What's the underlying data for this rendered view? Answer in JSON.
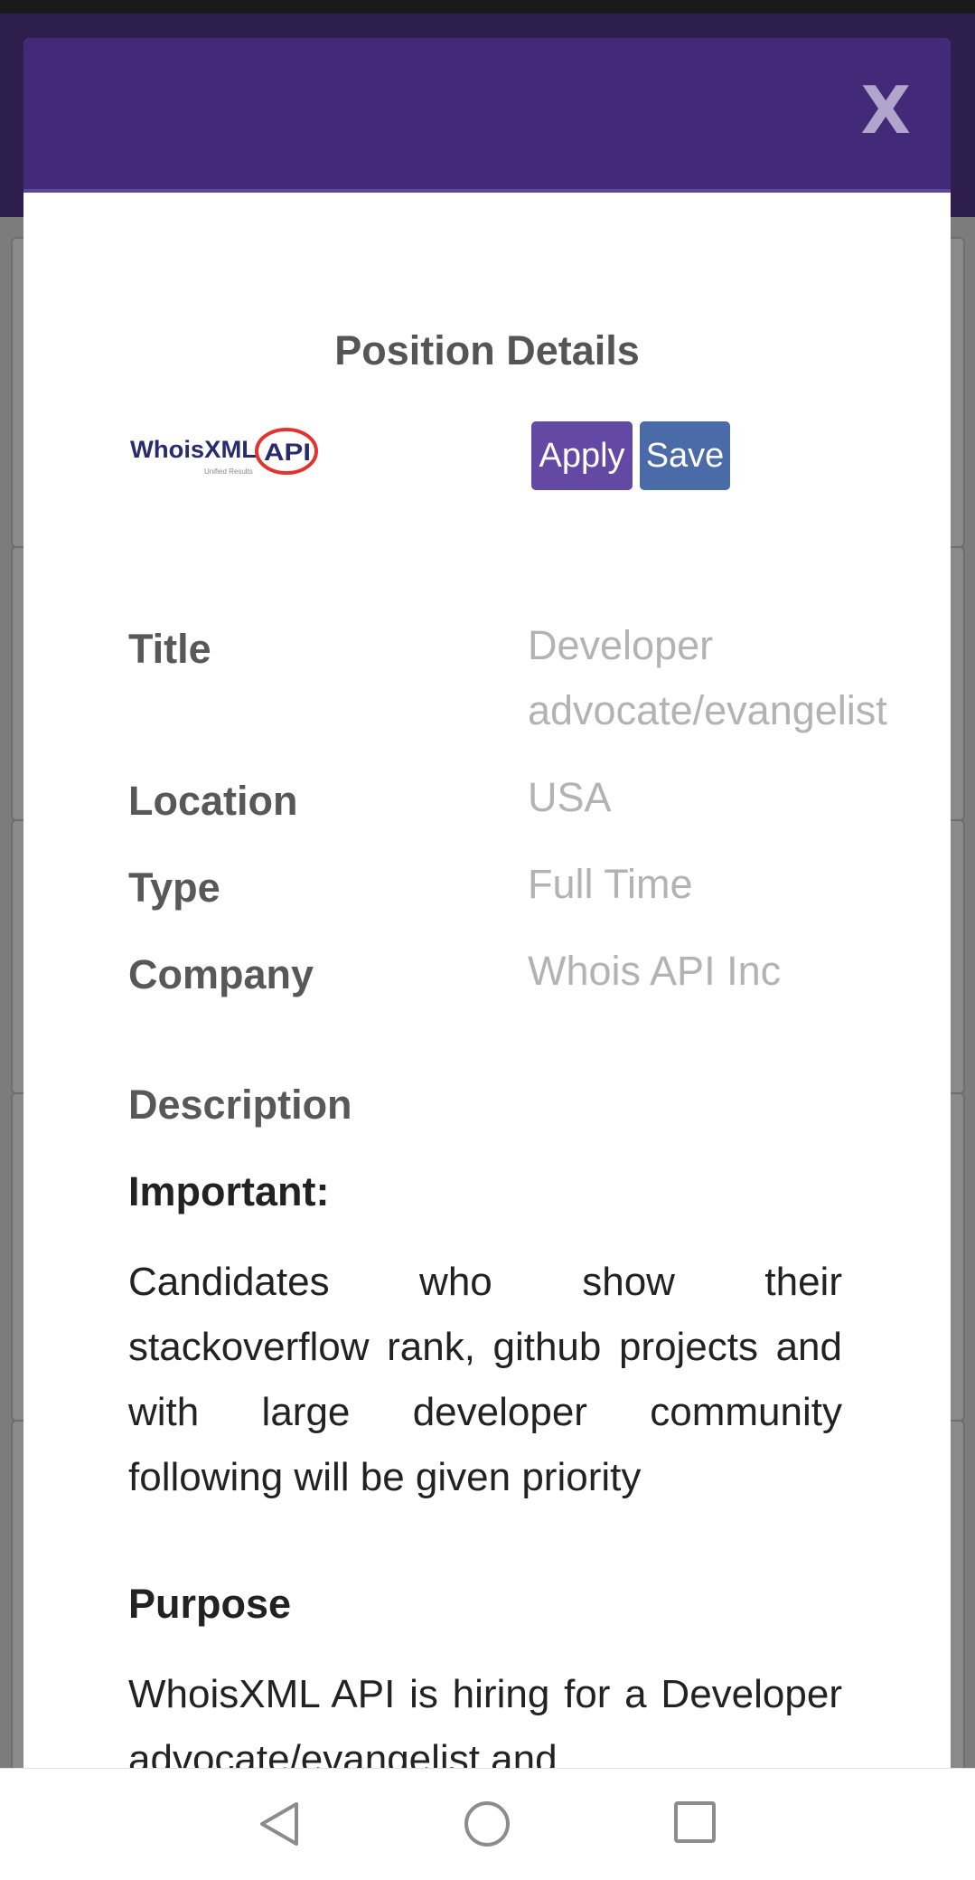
{
  "modal": {
    "close_label": "X",
    "title": "Position Details",
    "logo": {
      "icon": "whoisxml-api-logo",
      "text": "WhoisXML API",
      "tagline": "Unified Results"
    },
    "apply_label": "Apply",
    "save_label": "Save"
  },
  "fields": [
    {
      "label": "Title",
      "value": "Developer advocate/evangelist"
    },
    {
      "label": "Location",
      "value": "USA"
    },
    {
      "label": "Type",
      "value": "Full Time"
    },
    {
      "label": "Company",
      "value": "Whois API Inc"
    }
  ],
  "description": {
    "heading": "Description",
    "important_heading": "Important:",
    "important_text": "Candidates who show their stackoverflow rank, github projects and with large developer community following will be given priority",
    "purpose_heading": "Purpose",
    "purpose_text": "WhoisXML API is hiring for a Developer advocate/evangelist and"
  },
  "nav": {
    "icons": [
      "back-icon",
      "home-icon",
      "recents-icon"
    ]
  },
  "colors": {
    "header": "#432a79",
    "apply": "#6449a4",
    "save": "#4a6aa8"
  }
}
